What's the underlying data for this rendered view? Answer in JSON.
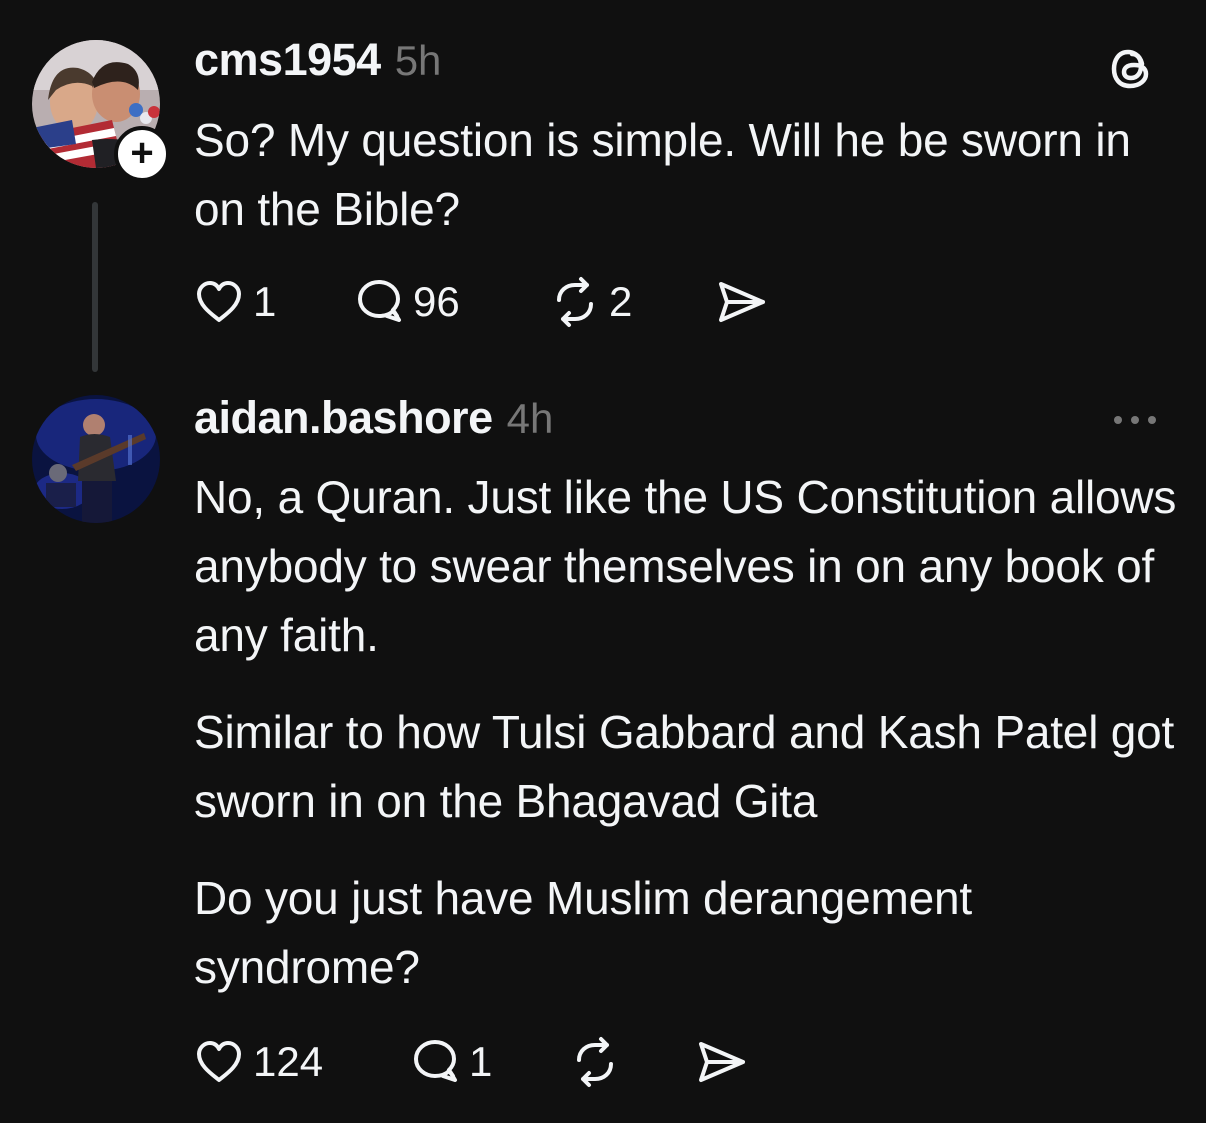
{
  "posts": [
    {
      "username": "cms1954",
      "time": "5h",
      "paragraphs": [
        "So? My question is simple. Will he be sworn in on the Bible?"
      ],
      "follow_badge": "+",
      "corner_icon": "threads-logo-icon",
      "counts": {
        "likes": "1",
        "replies": "96",
        "reposts": "2"
      }
    },
    {
      "username": "aidan.bashore",
      "time": "4h",
      "paragraphs": [
        "No, a Quran. Just like the US Constitution allows anybody to swear themselves in on any book of any faith.",
        "Similar to how Tulsi Gabbard and Kash Patel got sworn in on the Bhagavad Gita",
        "Do you just have Muslim derangement syndrome?"
      ],
      "corner_icon": "more-options-icon",
      "counts": {
        "likes": "124",
        "replies": "1"
      }
    }
  ],
  "colors": {
    "background": "#101010",
    "text": "#f3f5f7",
    "muted": "#777777",
    "thread_line": "#333638"
  }
}
